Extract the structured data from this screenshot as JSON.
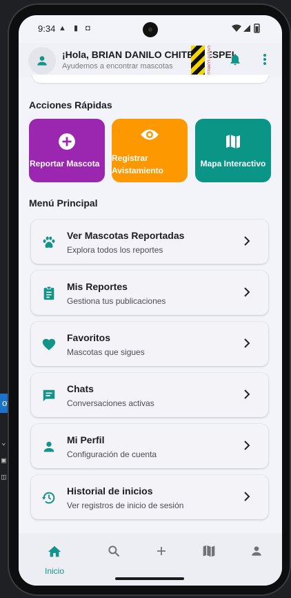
{
  "desktop": {
    "tab_fragment": "of"
  },
  "status_bar": {
    "time": "9:34"
  },
  "app_bar": {
    "greeting": "¡Hola, BRIAN DANILO CHITERI ESPEI",
    "subtitle": "Ayudemos a encontrar mascotas",
    "overflow_debug": "OVERFLOWED BY 2"
  },
  "quick_actions": {
    "title": "Acciones Rápidas",
    "items": [
      {
        "label": "Reportar Mascota",
        "icon": "add-circle-icon",
        "color": "#9b27b0"
      },
      {
        "label": "Registrar Avistamiento",
        "icon": "eye-icon",
        "color": "#fe9801"
      },
      {
        "label": "Mapa Interactivo",
        "icon": "map-icon",
        "color": "#0b9587"
      }
    ]
  },
  "main_menu": {
    "title": "Menú Principal",
    "items": [
      {
        "title": "Ver Mascotas Reportadas",
        "subtitle": "Explora todos los reportes",
        "icon": "paw-icon"
      },
      {
        "title": "Mis Reportes",
        "subtitle": "Gestiona tus publicaciones",
        "icon": "clipboard-icon"
      },
      {
        "title": "Favoritos",
        "subtitle": "Mascotas que sigues",
        "icon": "heart-icon"
      },
      {
        "title": "Chats",
        "subtitle": "Conversaciones activas",
        "icon": "chat-icon"
      },
      {
        "title": "Mi Perfil",
        "subtitle": "Configuración de cuenta",
        "icon": "person-icon"
      },
      {
        "title": "Historial de inicios",
        "subtitle": "Ver registros de inicio de sesión",
        "icon": "history-icon"
      }
    ]
  },
  "bottom_nav": {
    "active_label": "Inicio",
    "items": [
      "home-icon",
      "search-icon",
      "add-icon",
      "map-icon",
      "person-icon"
    ]
  },
  "colors": {
    "accent": "#13948a",
    "screen_bg": "#f3f4f9"
  }
}
